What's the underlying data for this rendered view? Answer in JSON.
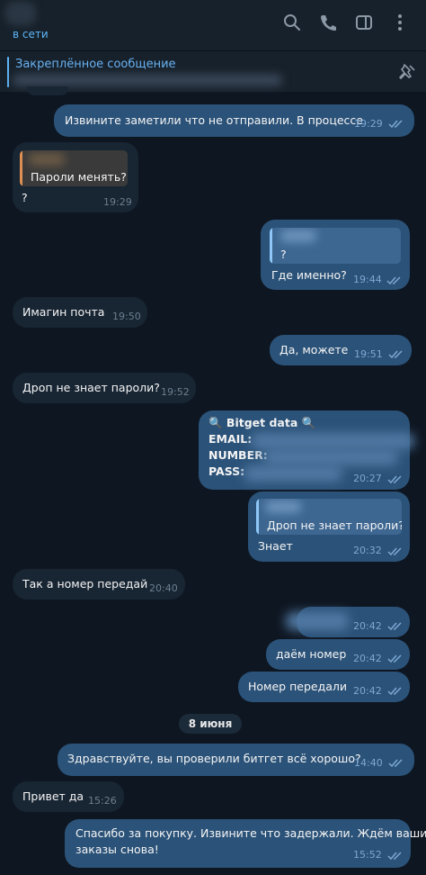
{
  "header": {
    "status": "в сети",
    "pinned_title": "Закреплённое сообщение"
  },
  "colors": {
    "background": "#0e1621",
    "incoming": "#182533",
    "outgoing": "#2b5278",
    "accent": "#5eb5f7"
  },
  "icons": {
    "search": "search-icon",
    "call": "phone-icon",
    "sidebar": "sidebar-icon",
    "more": "more-vertical-icon",
    "unpin": "pin-icon",
    "read": "double-check-icon"
  },
  "messages": {
    "m1": {
      "text": "Извините заметили что не отправили. В процессе",
      "time": "19:29"
    },
    "m2": {
      "reply": "Пароли менять?",
      "text": "?",
      "time": "19:29"
    },
    "m3": {
      "reply": "?",
      "text": "Где именно?",
      "time": "19:44"
    },
    "m4": {
      "text": "Имагин почта",
      "time": "19:50"
    },
    "m5": {
      "text": "Да, можете",
      "time": "19:51"
    },
    "m6": {
      "text": "Дроп не знает пароли?",
      "time": "19:52"
    },
    "m7": {
      "line1": "🔍 Bitget data 🔍",
      "line2": "EMAIL:",
      "line3": "NUMBER:",
      "line4": "PASS:",
      "time": "20:27"
    },
    "m8": {
      "reply": "Дроп не знает пароли?",
      "text": "Знает",
      "time": "20:32"
    },
    "m9": {
      "text": "Так а номер передай",
      "time": "20:40"
    },
    "m10": {
      "time": "20:42"
    },
    "m11": {
      "text": "даём номер",
      "time": "20:42"
    },
    "m12": {
      "text": "Номер передали",
      "time": "20:42"
    },
    "date": "8 июня",
    "m13": {
      "text": "Здравствуйте, вы проверили битгет всё хорошо?",
      "time": "14:40"
    },
    "m14": {
      "text": "Привет да",
      "time": "15:26"
    },
    "m15": {
      "line1": "Спасибо за покупку. Извините что задержали. Ждём ваши",
      "line2": "заказы снова!",
      "time": "15:52"
    }
  }
}
